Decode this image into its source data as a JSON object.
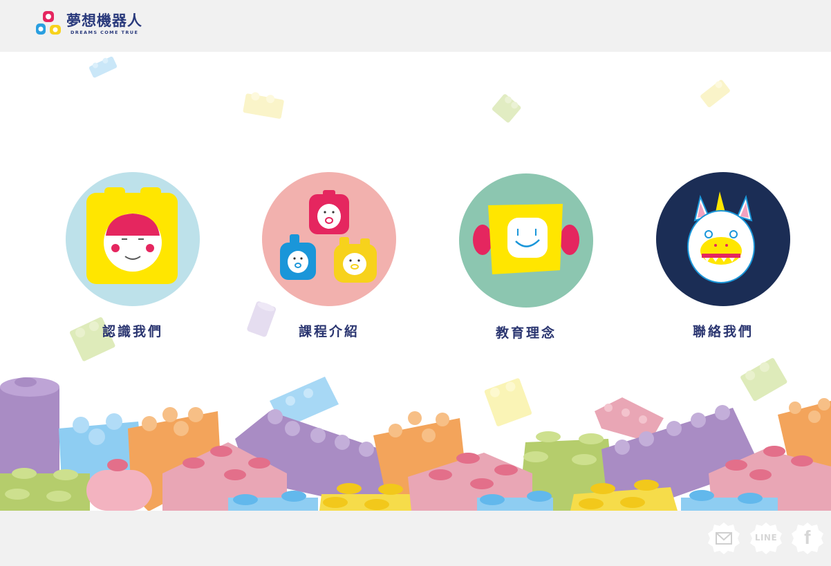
{
  "header": {
    "logo_title": "夢想機器人",
    "logo_subtitle": "DREAMS COME TRUE"
  },
  "nav": [
    {
      "label": "認識我們",
      "icon": "yellow-robot-face-icon"
    },
    {
      "label": "課程介紹",
      "icon": "three-robots-icon"
    },
    {
      "label": "教育理念",
      "icon": "smiling-robot-face-icon"
    },
    {
      "label": "聯絡我們",
      "icon": "unicorn-monster-icon"
    }
  ],
  "footer": {
    "social": [
      {
        "name": "mail",
        "icon": "mail-icon",
        "text": ""
      },
      {
        "name": "line",
        "icon": "line-icon",
        "text": "LINE"
      },
      {
        "name": "facebook",
        "icon": "facebook-icon",
        "text": "f"
      }
    ]
  },
  "colors": {
    "header_bg": "#f1f1f1",
    "nav_text": "#2a3570",
    "circle_1": "#bde1ea",
    "circle_2": "#f2b1ae",
    "circle_3": "#8cc6b0",
    "circle_4": "#1b2d55"
  }
}
